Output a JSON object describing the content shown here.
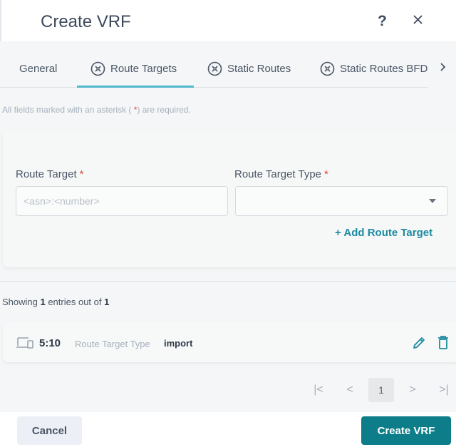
{
  "dialog": {
    "title": "Create VRF",
    "help_label": "?",
    "close_icon": "close-icon"
  },
  "tabs": [
    {
      "label": "General",
      "icon": null,
      "active": false
    },
    {
      "label": "Route Targets",
      "icon": "circle-x-icon",
      "active": true
    },
    {
      "label": "Static Routes",
      "icon": "circle-x-icon",
      "active": false
    },
    {
      "label": "Static Routes BFD",
      "icon": "circle-x-icon",
      "active": false
    }
  ],
  "tabs_scroll_icon": "chevron-right-icon",
  "required_note": {
    "before": "All fields marked with an asterisk ( ",
    "asterisk": "*",
    "after": ") are required."
  },
  "form": {
    "route_target": {
      "label": "Route Target",
      "required_mark": "*",
      "value": "",
      "placeholder": "<asn>:<number>"
    },
    "route_target_type": {
      "label": "Route Target Type",
      "required_mark": "*",
      "selected": ""
    },
    "add_link": "+ Add Route Target"
  },
  "list": {
    "showing_prefix": "Showing ",
    "showing_count": "1",
    "showing_mid": " entries out of ",
    "showing_total": "1",
    "entries": [
      {
        "icon": "devices-icon",
        "value": "5:10",
        "type_label": "Route Target Type",
        "type_value": "import"
      }
    ]
  },
  "pagination": {
    "first": "|<",
    "prev": "<",
    "current_page": "1",
    "next": ">",
    "last": ">|"
  },
  "footer": {
    "cancel_label": "Cancel",
    "create_label": "Create VRF"
  },
  "colors": {
    "accent": "#0d7e89",
    "tab_active": "#4eb8cc",
    "link": "#1d8aa0",
    "required": "#e0483a"
  }
}
